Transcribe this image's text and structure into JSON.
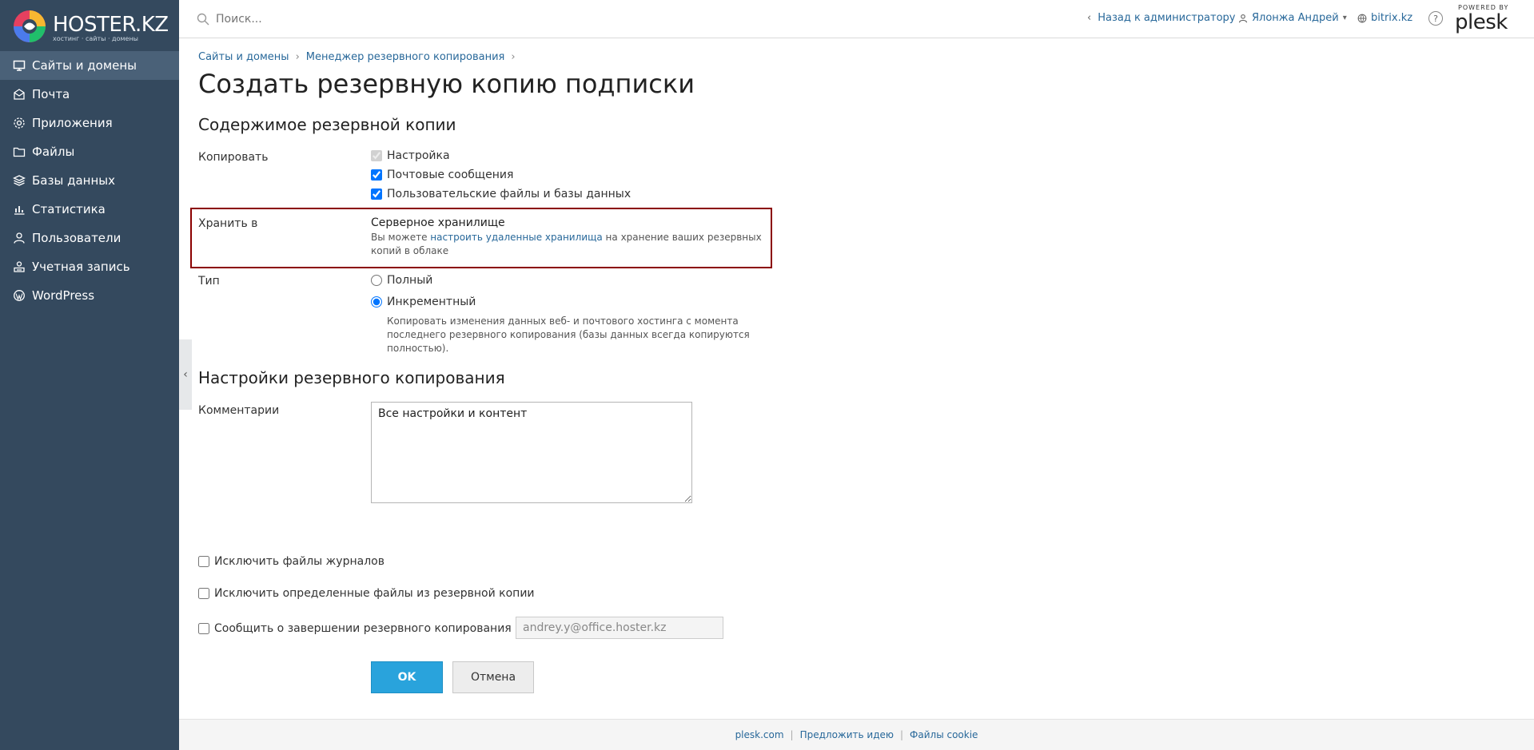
{
  "logo": {
    "text": "HOSTER.KZ",
    "tagline": "хостинг · сайты · домены"
  },
  "sidebar": {
    "items": [
      {
        "label": "Сайты и домены",
        "icon": "monitor-icon",
        "active": true
      },
      {
        "label": "Почта",
        "icon": "mail-icon"
      },
      {
        "label": "Приложения",
        "icon": "gear-icon"
      },
      {
        "label": "Файлы",
        "icon": "folder-icon"
      },
      {
        "label": "Базы данных",
        "icon": "layers-icon"
      },
      {
        "label": "Статистика",
        "icon": "bar-chart-icon"
      },
      {
        "label": "Пользователи",
        "icon": "user-icon"
      },
      {
        "label": "Учетная запись",
        "icon": "account-icon"
      },
      {
        "label": "WordPress",
        "icon": "wordpress-icon"
      }
    ]
  },
  "topbar": {
    "search_placeholder": "Поиск...",
    "back_link": "Назад к администратору",
    "user": "Ялонжа Андрей",
    "domain": "bitrix.kz",
    "plesk_powered": "POWERED BY",
    "plesk_logo": "plesk"
  },
  "breadcrumb": [
    "Сайты и домены",
    "Менеджер резервного копирования"
  ],
  "page_title": "Создать резервную копию подписки",
  "content_section": {
    "title": "Содержимое резервной копии",
    "copy_label": "Копировать",
    "copy_options": [
      {
        "label": "Настройка",
        "checked": true,
        "disabled": true
      },
      {
        "label": "Почтовые сообщения",
        "checked": true
      },
      {
        "label": "Пользовательские файлы и базы данных",
        "checked": true
      }
    ],
    "store_label": "Хранить в",
    "store_title": "Серверное хранилище",
    "store_desc_pre": "Вы можете ",
    "store_desc_link": "настроить удаленные хранилища",
    "store_desc_post": " на хранение ваших резервных копий в облаке",
    "type_label": "Тип",
    "type_full": "Полный",
    "type_incremental": "Инкрементный",
    "type_hint": "Копировать изменения данных веб- и почтового хостинга с момента последнего резервного копирования (базы данных всегда копируются полностью)."
  },
  "settings_section": {
    "title": "Настройки резервного копирования",
    "comment_label": "Комментарии",
    "comment_value": "Все настройки и контент",
    "exclude_logs": "Исключить файлы журналов",
    "exclude_files": "Исключить определенные файлы из резервной копии",
    "notify_label": "Сообщить о завершении резервного копирования на",
    "notify_email": "andrey.y@office.hoster.kz"
  },
  "buttons": {
    "ok": "OK",
    "cancel": "Отмена"
  },
  "footer": {
    "links": [
      "plesk.com",
      "Предложить идею",
      "Файлы cookie"
    ]
  },
  "colors": {
    "sidebar": "#34495e",
    "accent": "#29a3dc",
    "link": "#28689a",
    "highlight_border": "#8b0000"
  }
}
